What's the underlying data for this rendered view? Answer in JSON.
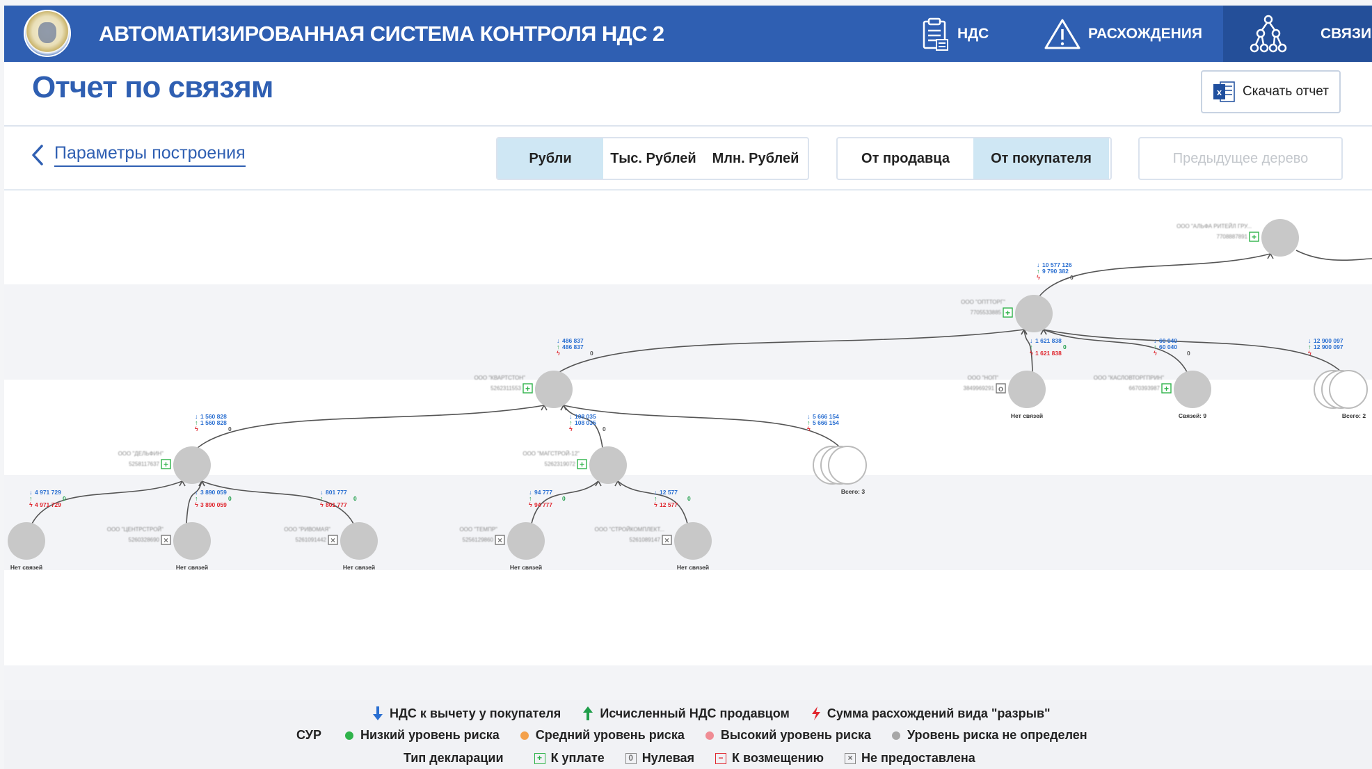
{
  "app": {
    "title": "АВТОМАТИЗИРОВАННАЯ СИСТЕМА КОНТРОЛЯ НДС 2",
    "nav": [
      {
        "label": "НДС",
        "icon": "clipboard-icon",
        "active": false
      },
      {
        "label": "РАСХОЖДЕНИЯ",
        "icon": "warning-triangle-icon",
        "active": false
      },
      {
        "label": "СВЯЗИ",
        "icon": "network-tree-icon",
        "active": true
      }
    ],
    "colors": {
      "brand": "#2f5fb2",
      "active_nav": "#244f99",
      "segment_active": "#cfe7f4",
      "deduction": "#2a6fd1",
      "seller": "#1f9e4a",
      "gap": "#e0262e"
    }
  },
  "header": {
    "page_title": "Отчет по связям",
    "download_label": "Скачать отчет"
  },
  "controls": {
    "back_label": "Параметры построения",
    "units": [
      "Рубли",
      "Тыс. Рублей",
      "Млн. Рублей"
    ],
    "units_selected": "Рубли",
    "direction": [
      "От продавца",
      "От покупателя"
    ],
    "direction_selected": "От покупателя",
    "prev_tree_label": "Предыдущее дерево"
  },
  "tree": {
    "nodes": [
      {
        "id": "n1",
        "name": "ООО \"АЛЬФА РИТЕЙЛ ГРУ...",
        "inn": "7708887891",
        "decl": "pay"
      },
      {
        "id": "n2",
        "name": "ООО \"ОПТТОРГ\"",
        "inn": "7705533885",
        "decl": "pay",
        "edge": {
          "deduction": "10 577 126",
          "seller": "9 790 382",
          "gap": "0"
        }
      },
      {
        "id": "n3",
        "name": "ООО \"КВАРТСТОН\"",
        "inn": "5262311553",
        "decl": "pay",
        "edge": {
          "deduction": "486 837",
          "seller": "486 837",
          "gap": "0"
        }
      },
      {
        "id": "n4",
        "name": "ООО \"НОП\"",
        "inn": "3849969291",
        "decl": "zero",
        "caption": "Нет связей",
        "edge": {
          "deduction": "1 621 838",
          "seller": "0",
          "gap": "1 621 838"
        }
      },
      {
        "id": "n5",
        "name": "ООО \"КАСЛОВТОРГПРИН\"",
        "inn": "6670393987",
        "decl": "pay",
        "caption": "Связей: 9",
        "edge": {
          "deduction": "60 040",
          "seller": "60 040",
          "gap": "0"
        }
      },
      {
        "id": "n6",
        "caption": "Всего: 2",
        "group": true,
        "edge": {
          "deduction": "12 900 097",
          "seller": "12 900 097",
          "gap": ""
        }
      },
      {
        "id": "n7",
        "name": "ООО \"ДЕЛЬФИН\"",
        "inn": "5258117637",
        "decl": "pay",
        "edge": {
          "deduction": "1 560 828",
          "seller": "1 560 828",
          "gap": "0"
        }
      },
      {
        "id": "n8",
        "name": "ООО \"МАГСТРОЙ-12\"",
        "inn": "5262319072",
        "decl": "pay",
        "edge": {
          "deduction": "108 035",
          "seller": "108 035",
          "gap": "0"
        }
      },
      {
        "id": "n9",
        "caption": "Всего: 3",
        "group": true,
        "edge": {
          "deduction": "5 666 154",
          "seller": "5 666 154",
          "gap": ""
        }
      },
      {
        "id": "n10",
        "caption": "Нет связей",
        "edge": {
          "deduction": "4 971 729",
          "seller": "0",
          "gap": "4 971 729"
        }
      },
      {
        "id": "n11",
        "name": "ООО \"ЦЕНТРСТРОЙ\"",
        "inn": "5260328690",
        "decl": "none",
        "caption": "Нет связей",
        "edge": {
          "deduction": "3 890 059",
          "seller": "0",
          "gap": "3 890 059"
        }
      },
      {
        "id": "n12",
        "name": "ООО \"РИВОМАЯ\"",
        "inn": "5261091442",
        "decl": "none",
        "caption": "Нет связей",
        "edge": {
          "deduction": "801 777",
          "seller": "0",
          "gap": "801 777"
        }
      },
      {
        "id": "n13",
        "name": "ООО \"ТЕМПР\"",
        "inn": "5256129860",
        "decl": "none",
        "caption": "Нет связей",
        "edge": {
          "deduction": "94 777",
          "seller": "0",
          "gap": "94 777"
        }
      },
      {
        "id": "n14",
        "name": "ООО \"СТРОЙКОМПЛЕКТ...",
        "inn": "5261089147",
        "decl": "none",
        "caption": "Нет связей",
        "edge": {
          "deduction": "12 577",
          "seller": "0",
          "gap": "12 577"
        }
      }
    ]
  },
  "legend": {
    "arrows": [
      {
        "label": "НДС к вычету у покупателя",
        "icon": "arrow-down-icon",
        "color": "#2a6fd1"
      },
      {
        "label": "Исчисленный НДС продавцом",
        "icon": "arrow-up-icon",
        "color": "#1f9e4a"
      },
      {
        "label": "Сумма расхождений вида \"разрыв\"",
        "icon": "lightning-icon",
        "color": "#e0262e"
      }
    ],
    "risk_title": "СУР",
    "risk": [
      {
        "label": "Низкий уровень риска",
        "color": "#2fb34a"
      },
      {
        "label": "Средний уровень риска",
        "color": "#f4a14b"
      },
      {
        "label": "Высокий уровень риска",
        "color": "#f08c94"
      },
      {
        "label": "Уровень риска не определен",
        "color": "#a7a7a7"
      }
    ],
    "decl_title": "Тип декларации",
    "decl": [
      {
        "label": "К уплате",
        "icon": "plus-box-icon"
      },
      {
        "label": "Нулевая",
        "icon": "zero-box-icon"
      },
      {
        "label": "К возмещению",
        "icon": "minus-box-icon"
      },
      {
        "label": "Не предоставлена",
        "icon": "cross-box-icon"
      }
    ]
  }
}
